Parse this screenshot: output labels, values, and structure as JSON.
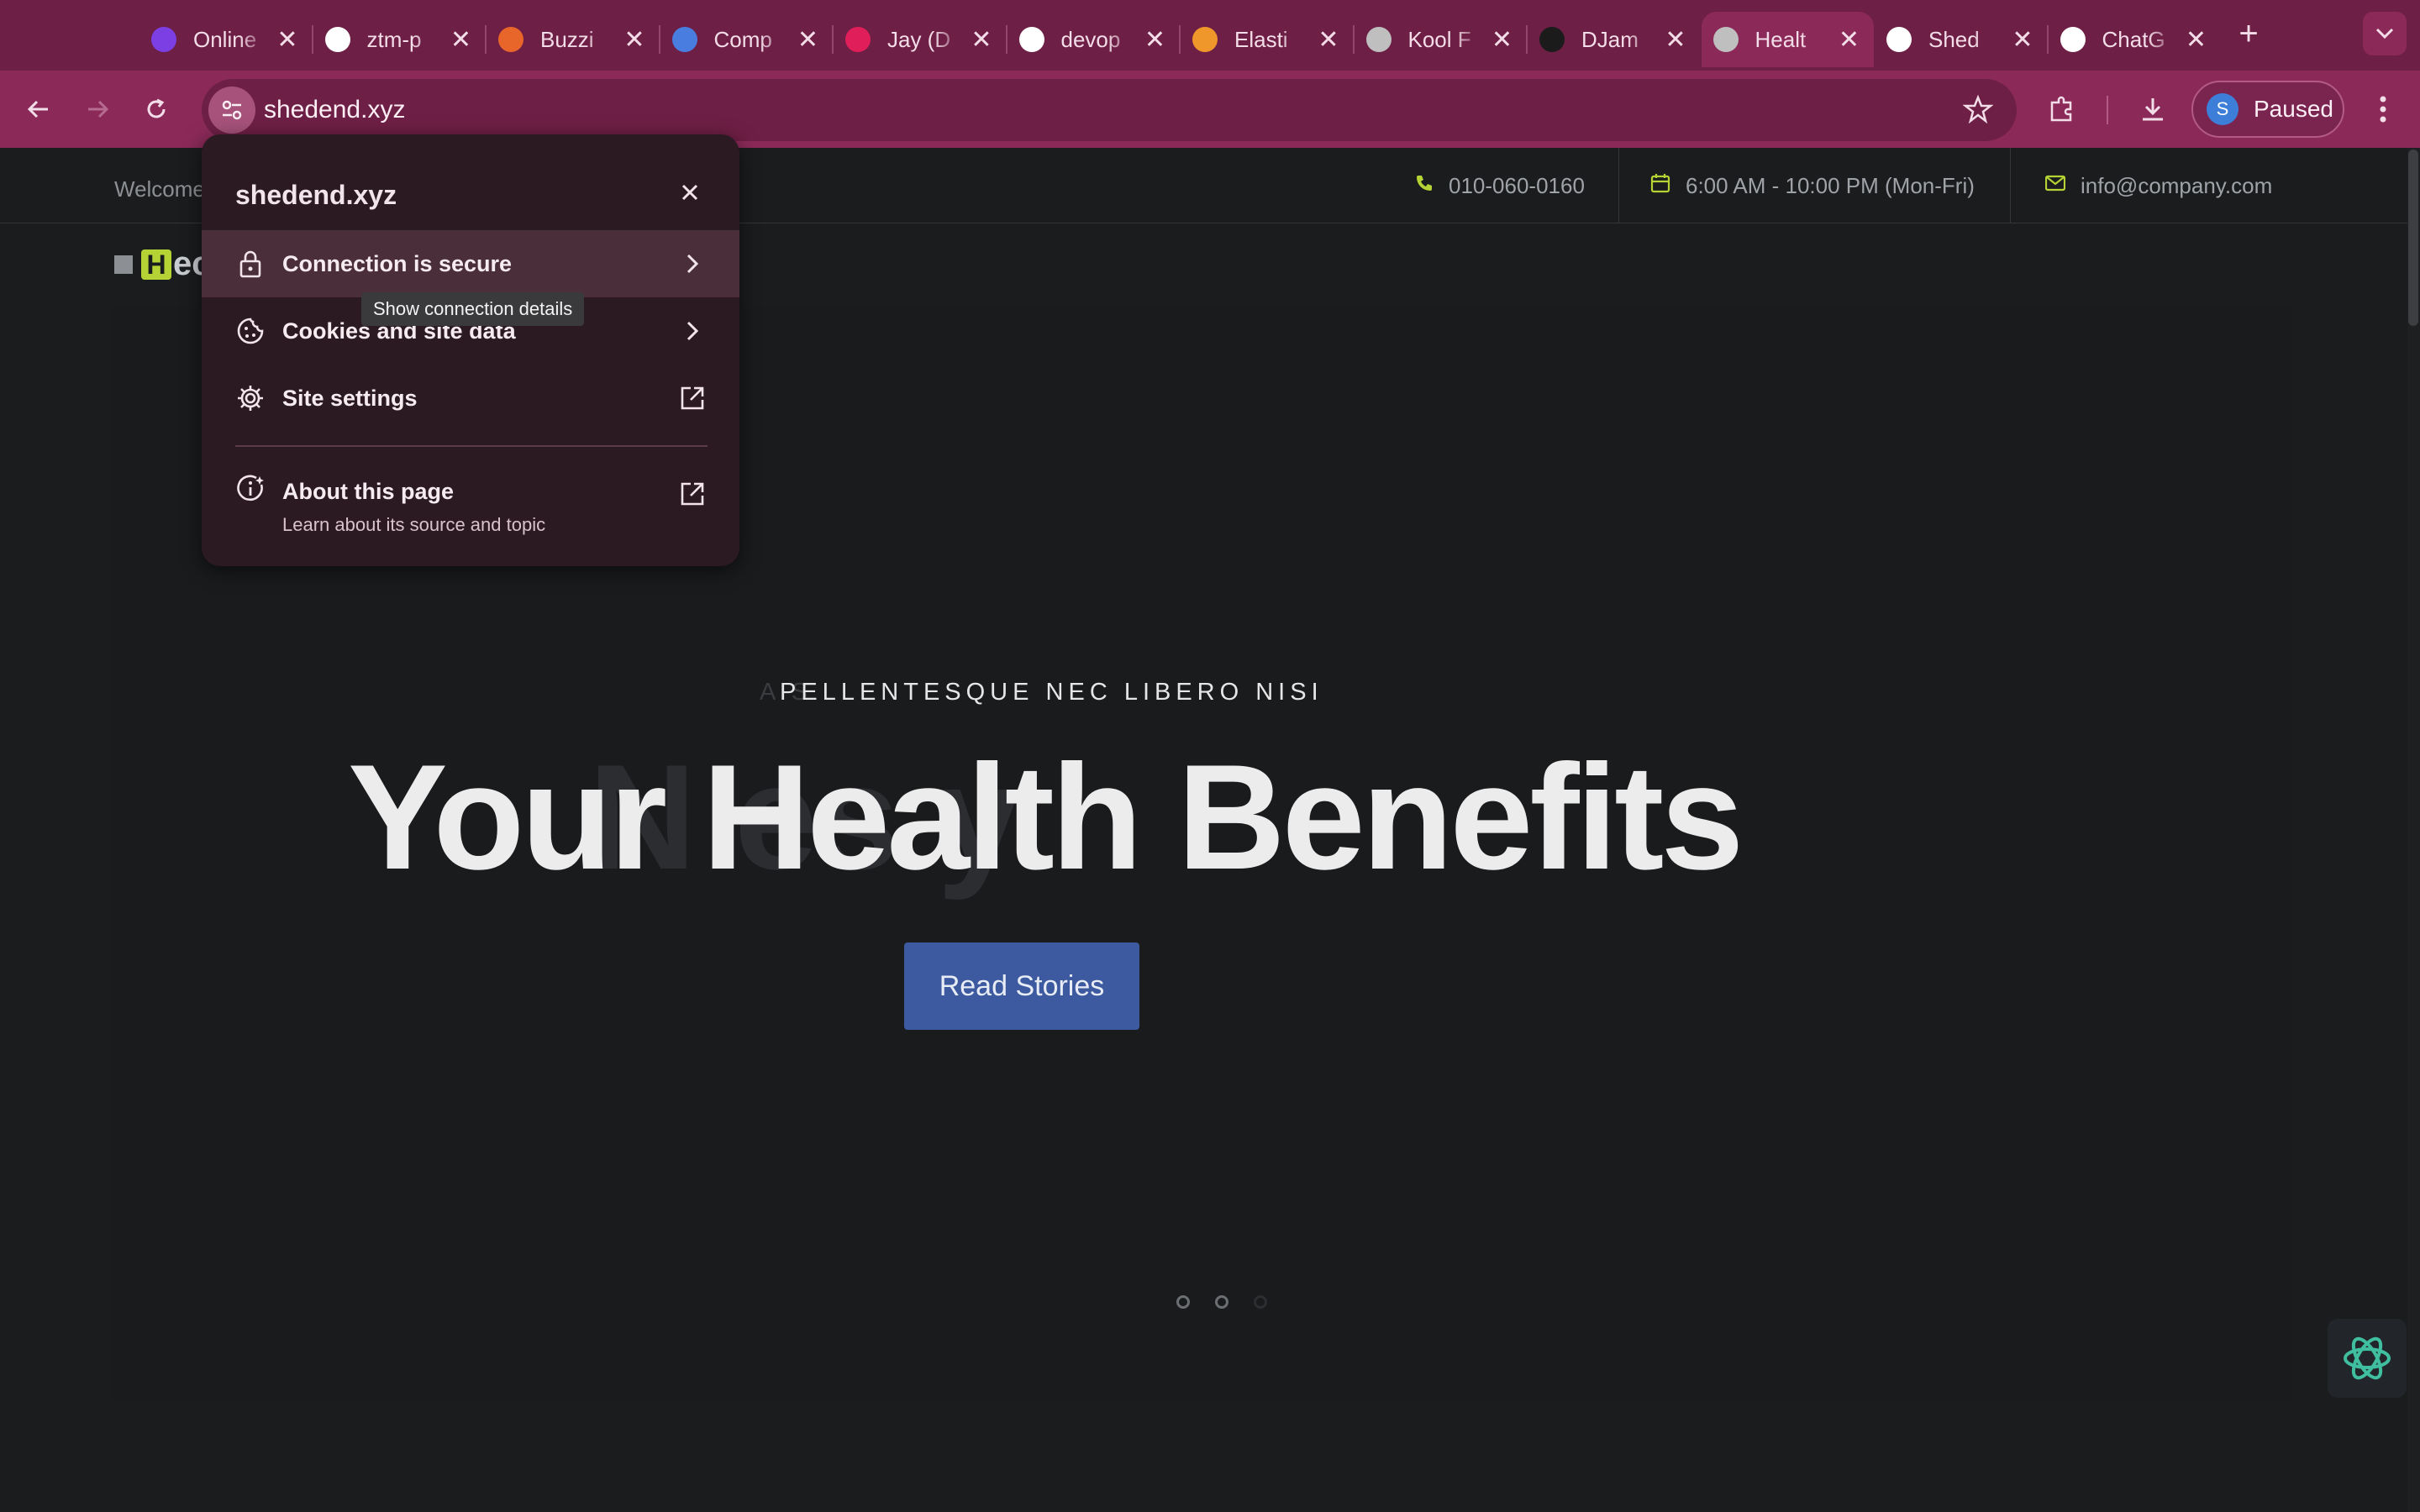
{
  "browser": {
    "tabs": [
      {
        "title": "Online",
        "favicon": "u-icon",
        "color": "#7b3fe4"
      },
      {
        "title": "ztm-p",
        "favicon": "github-icon",
        "color": "#ffffff"
      },
      {
        "title": "Buzzi",
        "favicon": "buzzi-icon",
        "color": "#e8662a"
      },
      {
        "title": "Comp",
        "favicon": "pb-icon",
        "color": "#4a7de0"
      },
      {
        "title": "Jay (D",
        "favicon": "slack-icon",
        "color": "#e01e5a"
      },
      {
        "title": "devop",
        "favicon": "github-icon",
        "color": "#ffffff"
      },
      {
        "title": "Elasti",
        "favicon": "elastic-icon",
        "color": "#f0972b"
      },
      {
        "title": "Kool F",
        "favicon": "globe-icon",
        "color": "#bfbfbf"
      },
      {
        "title": "DJam",
        "favicon": "djam-icon",
        "color": "#1b1b1b"
      },
      {
        "title": "Healt",
        "favicon": "globe-icon",
        "color": "#bfbfbf",
        "active": true
      },
      {
        "title": "Shed",
        "favicon": "github-icon",
        "color": "#ffffff"
      },
      {
        "title": "ChatG",
        "favicon": "chatgpt-icon",
        "color": "#ffffff"
      }
    ],
    "close_glyph": "✕",
    "new_tab_glyph": "+",
    "url": "shedend.xyz",
    "profile_initial": "S",
    "profile_status": "Paused",
    "accent": "#8b2a59"
  },
  "page": {
    "welcome": "Welcome",
    "phone": "010-060-0160",
    "hours": "6:00 AM - 10:00 PM (Mon-Fri)",
    "email": "info@company.com",
    "logo_letter": "H",
    "logo_rest": "ec",
    "kicker": "PELLENTESQUE NEC LIBERO NISI",
    "kicker_ghost": "A                                           S",
    "headline": "Your Health Benefits",
    "ghost_headline": "N           es   y    ",
    "cta": "Read Stories",
    "accent": "#b5d334",
    "button_color": "#3d5aa0"
  },
  "popup": {
    "title": "shedend.xyz",
    "items": [
      {
        "label": "Connection is secure"
      },
      {
        "label": "Cookies and site data"
      },
      {
        "label": "Site settings"
      }
    ],
    "about_label": "About this page",
    "about_sub": "Learn about its source and topic",
    "tooltip": "Show connection details"
  }
}
